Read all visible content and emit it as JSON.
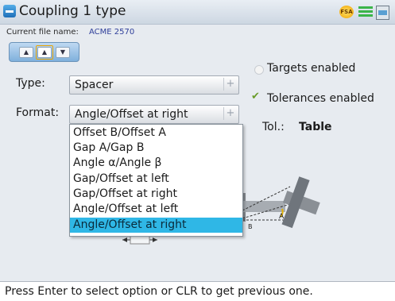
{
  "window": {
    "title": "Coupling 1 type"
  },
  "status_icons": [
    {
      "name": "status-indicator-icon",
      "text": "FSA"
    },
    {
      "name": "battery-icon"
    },
    {
      "name": "grid-display-icon"
    }
  ],
  "file": {
    "label": "Current file name:",
    "name": "ACME 2570"
  },
  "mini_toolbar": {
    "buttons": [
      "▲",
      "▲",
      "▼"
    ]
  },
  "form": {
    "type_label": "Type:",
    "type_value": "Spacer",
    "format_label": "Format:",
    "format_value": "Angle/Offset at right",
    "dropdown_arrow": "+"
  },
  "options": {
    "targets_label": "Targets enabled",
    "targets_checked": false,
    "tolerances_label": "Tolerances enabled",
    "tolerances_checked": true,
    "tol_label": "Tol.:",
    "tol_value": "Table"
  },
  "format_options": [
    "Offset B/Offset A",
    "Gap A/Gap B",
    "Angle α/Angle β",
    "Gap/Offset at left",
    "Gap/Offset at right",
    "Angle/Offset at left",
    "Angle/Offset at right"
  ],
  "selected_format_index": 6,
  "diagram": {
    "angle_label": "A",
    "offset_label": "B"
  },
  "statusbar": {
    "message": "Press Enter to select option or CLR to get previous one."
  },
  "colors": {
    "selection": "#2fb7e6",
    "check": "#6a9c2a",
    "file_name": "#2f3f9a"
  }
}
